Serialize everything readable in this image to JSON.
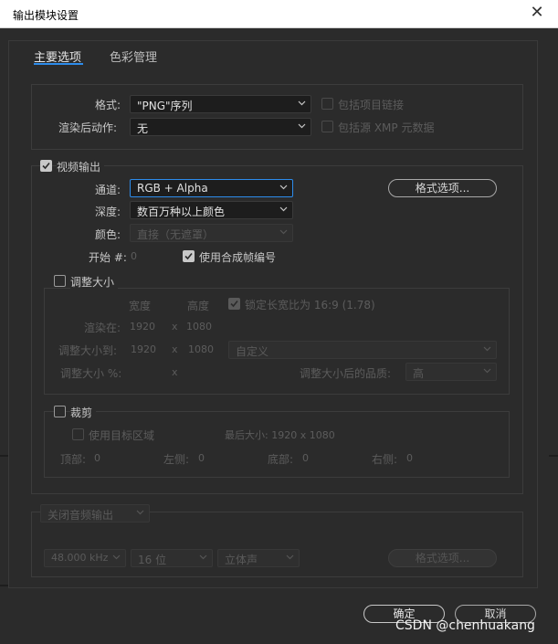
{
  "window": {
    "title": "输出模块设置",
    "close_icon": "close-icon"
  },
  "tabs": [
    {
      "label": "主要选项",
      "active": true
    },
    {
      "label": "色彩管理",
      "active": false
    }
  ],
  "format_section": {
    "format_label": "格式:",
    "format_value": "\"PNG\"序列",
    "post_render_label": "渲染后动作:",
    "post_render_value": "无",
    "include_project_link_label": "包括项目链接",
    "include_source_xmp_label": "包括源 XMP 元数据"
  },
  "video_output": {
    "checkbox_label": "视频输出",
    "checked": true,
    "channels_label": "通道:",
    "channels_value": "RGB + Alpha",
    "format_options_button": "格式选项...",
    "depth_label": "深度:",
    "depth_value": "数百万种以上颜色",
    "color_label": "颜色:",
    "color_value": "直接（无遮罩）",
    "start_label": "开始 #:",
    "start_value": "0",
    "use_comp_frame_label": "使用合成帧编号",
    "use_comp_frame_checked": true
  },
  "resize": {
    "checkbox_label": "调整大小",
    "checked": false,
    "width_header": "宽度",
    "height_header": "高度",
    "lock_aspect_label": "锁定长宽比为 16:9 (1.78)",
    "lock_aspect_checked": true,
    "render_at_label": "渲染在:",
    "render_at_w": "1920",
    "render_at_x": "x",
    "render_at_h": "1080",
    "resize_to_label": "调整大小到:",
    "resize_to_w": "1920",
    "resize_to_x": "x",
    "resize_to_h": "1080",
    "preset_value": "自定义",
    "resize_pct_label": "调整大小 %:",
    "resize_pct_x": "x",
    "quality_label": "调整大小后的品质:",
    "quality_value": "高"
  },
  "crop": {
    "checkbox_label": "裁剪",
    "checked": false,
    "use_roi_label": "使用目标区域",
    "final_size_label": "最后大小: 1920 x 1080",
    "top_label": "顶部:",
    "top_value": "0",
    "left_label": "左侧:",
    "left_value": "0",
    "bottom_label": "底部:",
    "bottom_value": "0",
    "right_label": "右侧:",
    "right_value": "0"
  },
  "audio": {
    "mode_value": "关闭音频输出",
    "sample_rate": "48.000 kHz",
    "bit_depth": "16 位",
    "channels": "立体声",
    "format_options_button": "格式选项..."
  },
  "footer": {
    "ok_button": "确定",
    "cancel_button": "取消"
  },
  "watermark": "CSDN @chenhuakang",
  "colors": {
    "accent": "#2d8ceb",
    "panel": "#2b2b2b",
    "field": "#1d1d1d"
  }
}
